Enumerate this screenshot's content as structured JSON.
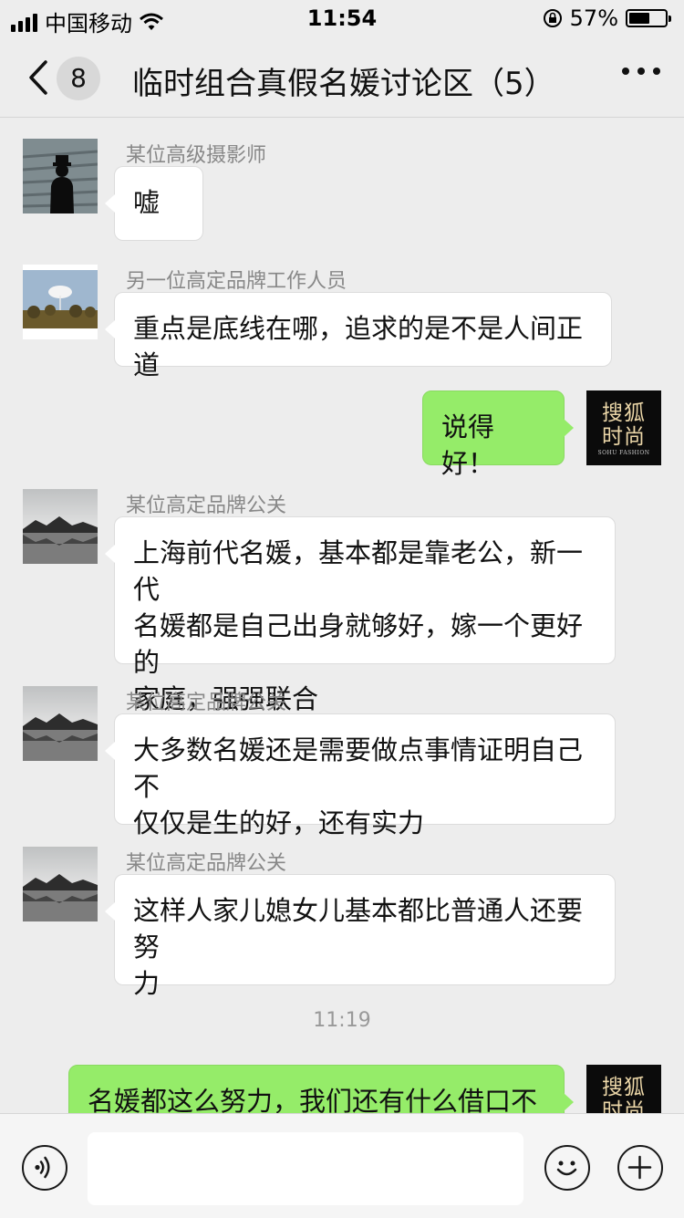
{
  "status_bar": {
    "carrier": "中国移动",
    "time": "11:54",
    "battery": "57%",
    "battery_level": 0.57
  },
  "nav": {
    "unread_count": "8",
    "title": "临时组合真假名媛讨论区（5）"
  },
  "messages": [
    {
      "sender": "某位高级摄影师",
      "text": "嘘"
    },
    {
      "sender": "另一位高定品牌工作人员",
      "text": "重点是底线在哪，追求的是不是人间正道"
    },
    {
      "text": "说得好！"
    },
    {
      "sender": "某位高定品牌公关",
      "lines": [
        "上海前代名媛，基本都是靠老公，新一代",
        "名媛都是自己出身就够好，嫁一个更好的",
        "家庭，强强联合"
      ]
    },
    {
      "sender": "某位高定品牌公关",
      "lines": [
        "大多数名媛还是需要做点事情证明自己不",
        "仅仅是生的好，还有实力"
      ]
    },
    {
      "sender": "某位高定品牌公关",
      "lines": [
        "这样人家儿媳女儿基本都比普通人还要努",
        "力"
      ]
    },
    {
      "text": "名媛都这么努力，我们还有什么借口不"
    }
  ],
  "timestamp": "11:19",
  "self_avatar": {
    "line1": "搜狐",
    "line2": "时尚",
    "line3": "SOHU FASHION"
  },
  "input": {
    "placeholder": ""
  }
}
